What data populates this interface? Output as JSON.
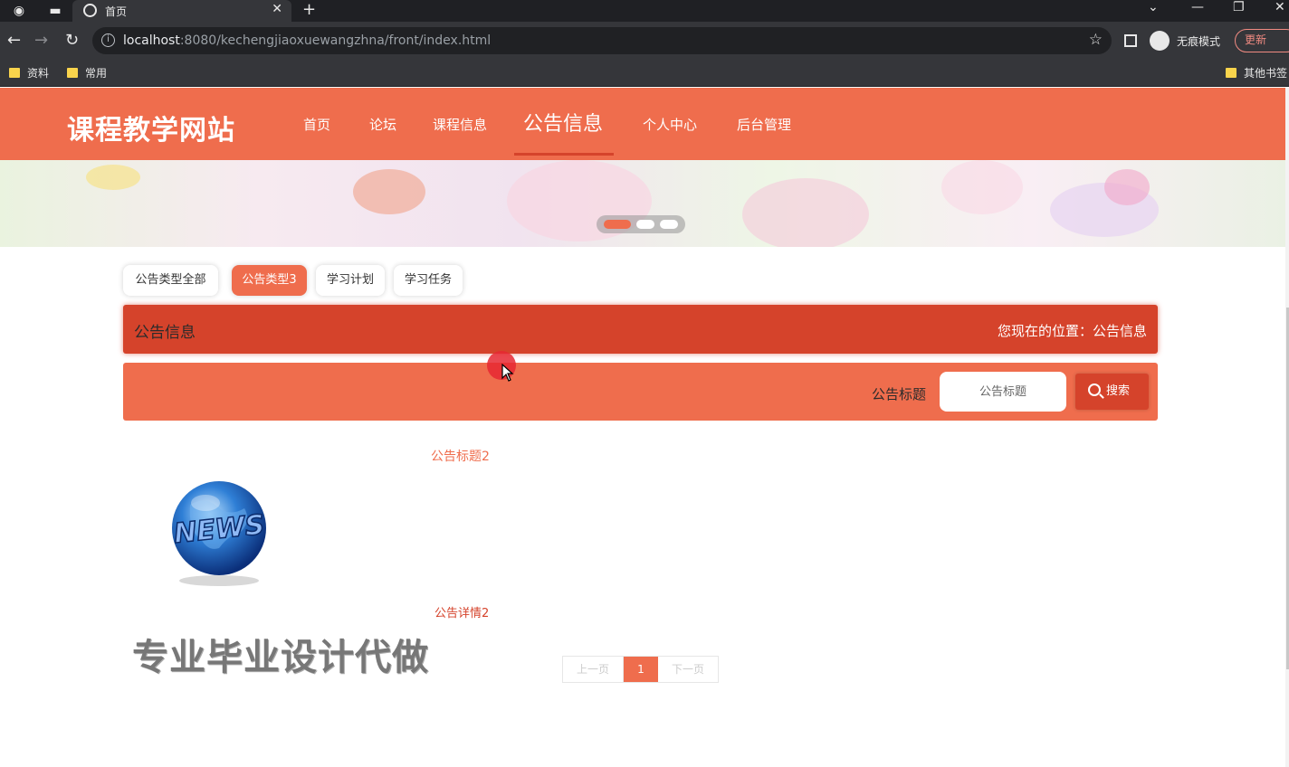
{
  "browser": {
    "tab_title": "首页",
    "url_host": "localhost",
    "url_rest": ":8080/kechengjiaoxuewangzhna/front/index.html",
    "incognito_label": "无痕模式",
    "update_label": "更新",
    "bookmarks": [
      "资料",
      "常用"
    ],
    "other_bookmarks": "其他书签"
  },
  "site": {
    "title": "课程教学网站",
    "nav": [
      "首页",
      "论坛",
      "课程信息",
      "公告信息",
      "个人中心",
      "后台管理"
    ],
    "active_nav_index": 3
  },
  "categories": [
    "公告类型全部",
    "公告类型3",
    "学习计划",
    "学习任务"
  ],
  "active_category_index": 1,
  "section": {
    "title": "公告信息",
    "location": "您现在的位置：公告信息"
  },
  "search": {
    "label": "公告标题",
    "placeholder": "公告标题",
    "button_label": "搜索"
  },
  "news": {
    "title": "公告标题2",
    "image_text": "NEWS",
    "detail": "公告详情2",
    "watermark": "专业毕业设计代做"
  },
  "pagination": {
    "prev": "上一页",
    "current": "1",
    "next": "下一页"
  },
  "colors": {
    "primary": "#ef6d4d",
    "primary_dark": "#d5432b"
  }
}
